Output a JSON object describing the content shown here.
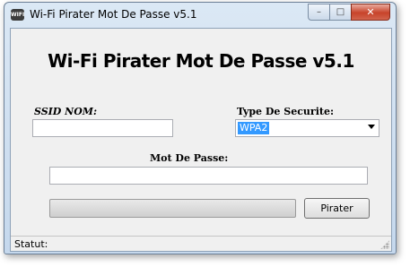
{
  "window": {
    "title": "Wi-Fi Pirater Mot De Passe v5.1",
    "app_icon_text": "WIFI",
    "caption_buttons": {
      "minimize": "–",
      "maximize": "□",
      "close": "✕"
    }
  },
  "main": {
    "heading": "Wi-Fi Pirater Mot De Passe v5.1",
    "ssid": {
      "label": "SSID NOM:",
      "value": ""
    },
    "security": {
      "label": "Type De Securite:",
      "selected": "WPA2"
    },
    "password": {
      "label": "Mot De Passe:",
      "value": ""
    },
    "progress": {
      "value": 0.0
    },
    "crack_button": {
      "label": "Pirater"
    }
  },
  "status": {
    "label": "Statut:"
  },
  "colors": {
    "selection": "#3399ff",
    "close_button": "#c7432a",
    "progress_fill": "#06b025"
  }
}
